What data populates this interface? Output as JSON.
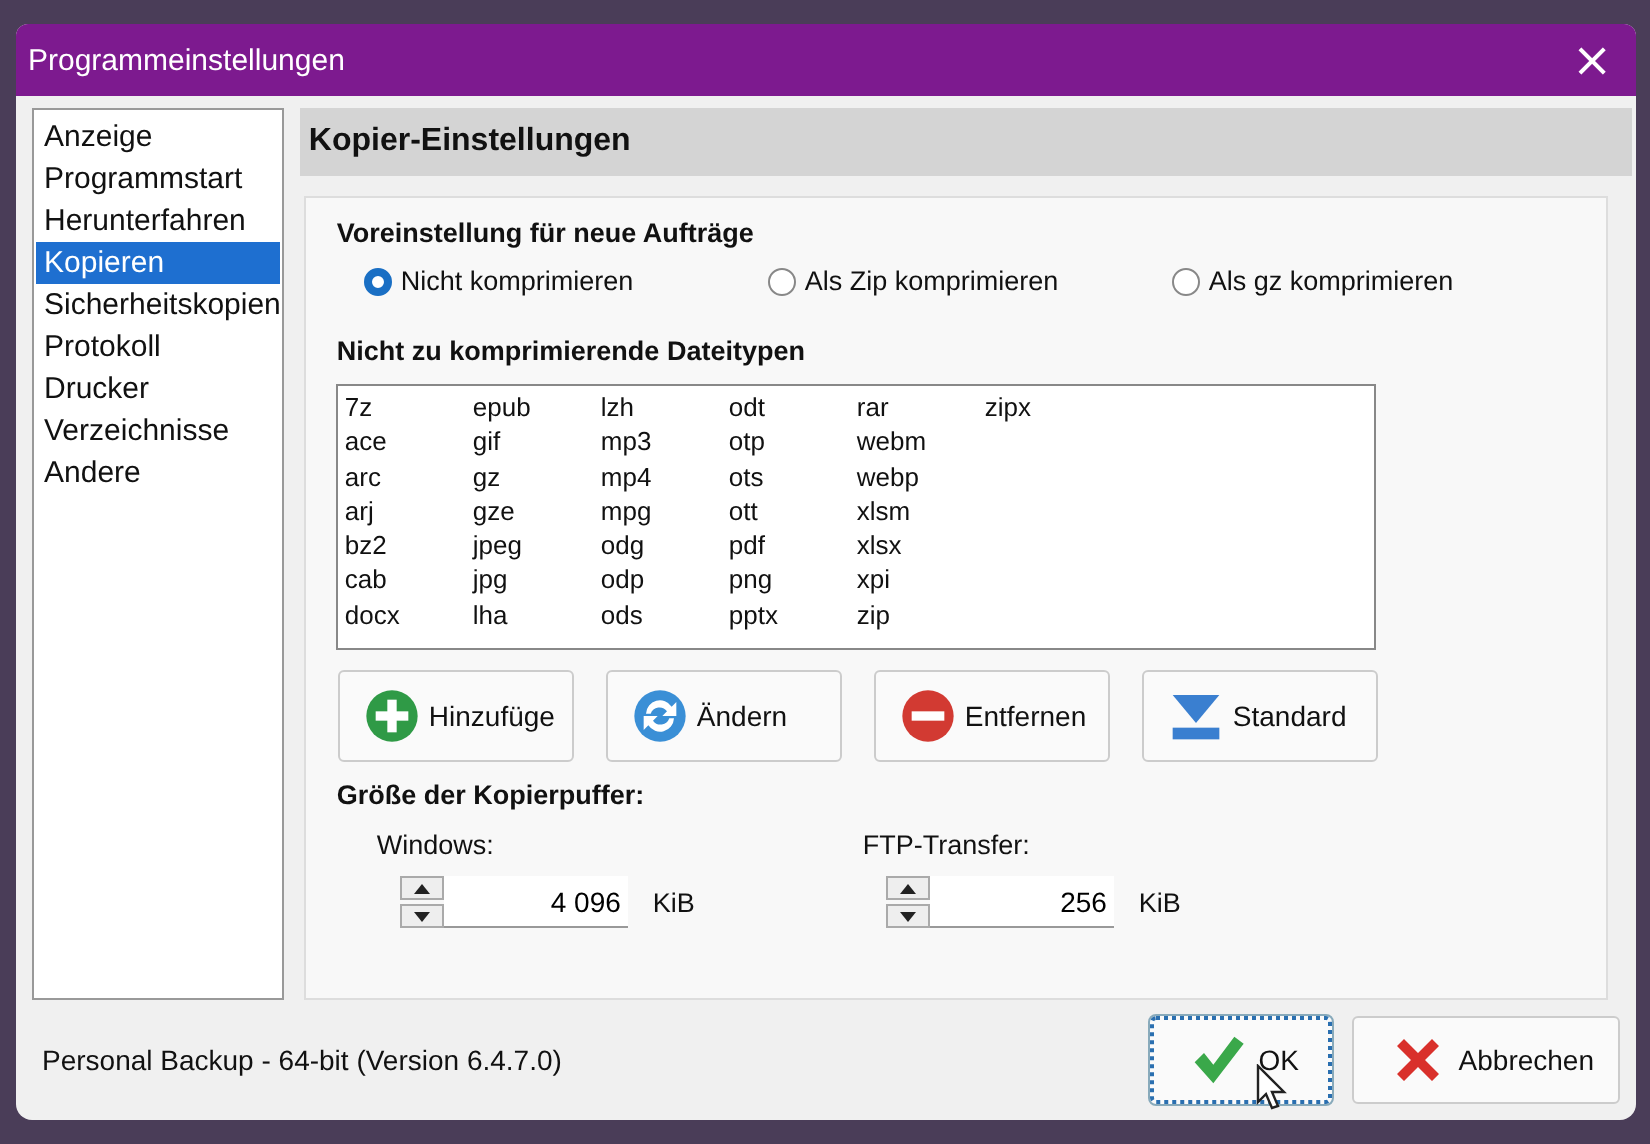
{
  "window": {
    "title": "Programmeinstellungen",
    "close": "×"
  },
  "sidebar": {
    "items": [
      {
        "label": "Anzeige",
        "selected": false
      },
      {
        "label": "Programmstart",
        "selected": false
      },
      {
        "label": "Herunterfahren",
        "selected": false
      },
      {
        "label": "Kopieren",
        "selected": true
      },
      {
        "label": "Sicherheitskopien",
        "selected": false
      },
      {
        "label": "Protokoll",
        "selected": false
      },
      {
        "label": "Drucker",
        "selected": false
      },
      {
        "label": "Verzeichnisse",
        "selected": false
      },
      {
        "label": "Andere",
        "selected": false
      }
    ]
  },
  "panel": {
    "title": "Kopier-Einstellungen",
    "preset": {
      "heading": "Voreinstellung für neue Aufträge",
      "options": [
        {
          "label": "Nicht komprimieren",
          "selected": true
        },
        {
          "label": "Als Zip komprimieren",
          "selected": false
        },
        {
          "label": "Als gz komprimieren",
          "selected": false
        }
      ]
    },
    "file_types": {
      "heading": "Nicht zu komprimierende Dateitypen",
      "columns": [
        [
          "7z",
          "ace",
          "arc",
          "arj",
          "bz2",
          "cab",
          "docx"
        ],
        [
          "epub",
          "gif",
          "gz",
          "gze",
          "jpeg",
          "jpg",
          "lha"
        ],
        [
          "lzh",
          "mp3",
          "mp4",
          "mpg",
          "odg",
          "odp",
          "ods"
        ],
        [
          "odt",
          "otp",
          "ots",
          "ott",
          "pdf",
          "png",
          "pptx"
        ],
        [
          "rar",
          "webm",
          "webp",
          "xlsm",
          "xlsx",
          "xpi",
          "zip"
        ],
        [
          "zipx"
        ]
      ]
    },
    "buttons": [
      {
        "label": "Hinzufüge",
        "kind": "add"
      },
      {
        "label": "Ändern",
        "kind": "refresh"
      },
      {
        "label": "Entfernen",
        "kind": "remove"
      },
      {
        "label": "Standard",
        "kind": "default"
      }
    ],
    "buffer": {
      "heading": "Größe der Kopierpuffer:",
      "fields": [
        {
          "label": "Windows:",
          "value": "4 096",
          "unit": "KiB"
        },
        {
          "label": "FTP-Transfer:",
          "value": "256",
          "unit": "KiB"
        }
      ]
    }
  },
  "status_bar": "Personal Backup - 64-bit (Version 6.4.7.0)",
  "dialog_buttons": [
    {
      "label": "OK",
      "kind": "check",
      "focused": true
    },
    {
      "label": "Abbrechen",
      "kind": "cross",
      "focused": false
    }
  ]
}
